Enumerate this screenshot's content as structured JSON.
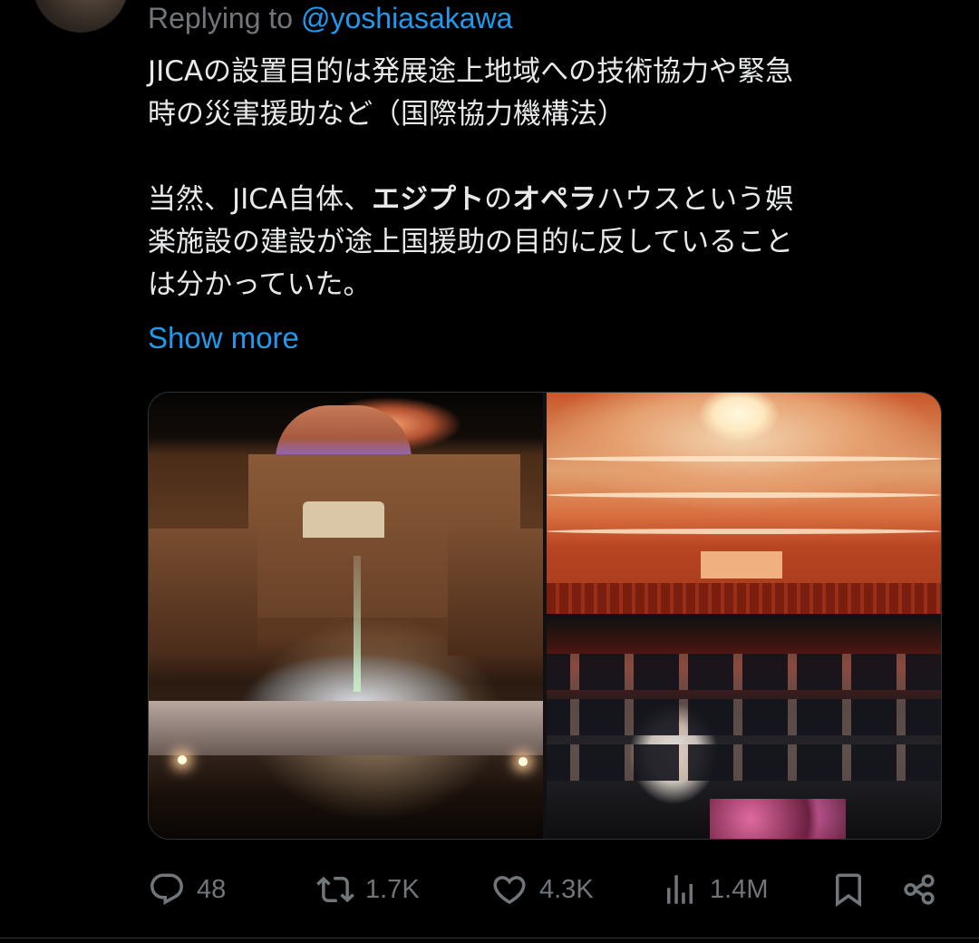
{
  "reply": {
    "prefix": "Replying to ",
    "handle": "@yoshiasakawa"
  },
  "tweet": {
    "line1": "JICAの設置目的は発展途上地域への技術協力や緊急",
    "line2": "時の災害援助など（国際協力機構法）",
    "para2_a": "当然、JICA自体、",
    "para2_bold1": "エジプト",
    "para2_b": "の",
    "para2_bold2": "オペラ",
    "para2_c": "ハウスという娯",
    "line4": "楽施設の建設が途上国援助の目的に反していること",
    "line5": "は分かっていた。",
    "show_more": "Show more"
  },
  "actions": {
    "replies": "48",
    "reposts": "1.7K",
    "likes": "4.3K",
    "views": "1.4M"
  },
  "icons": {
    "reply": "reply-icon",
    "repost": "repost-icon",
    "like": "heart-icon",
    "views": "views-icon",
    "bookmark": "bookmark-icon",
    "share": "share-icon"
  },
  "colors": {
    "background": "#000000",
    "text": "#e7e9ea",
    "muted": "#71767b",
    "link": "#1d9bf0"
  }
}
